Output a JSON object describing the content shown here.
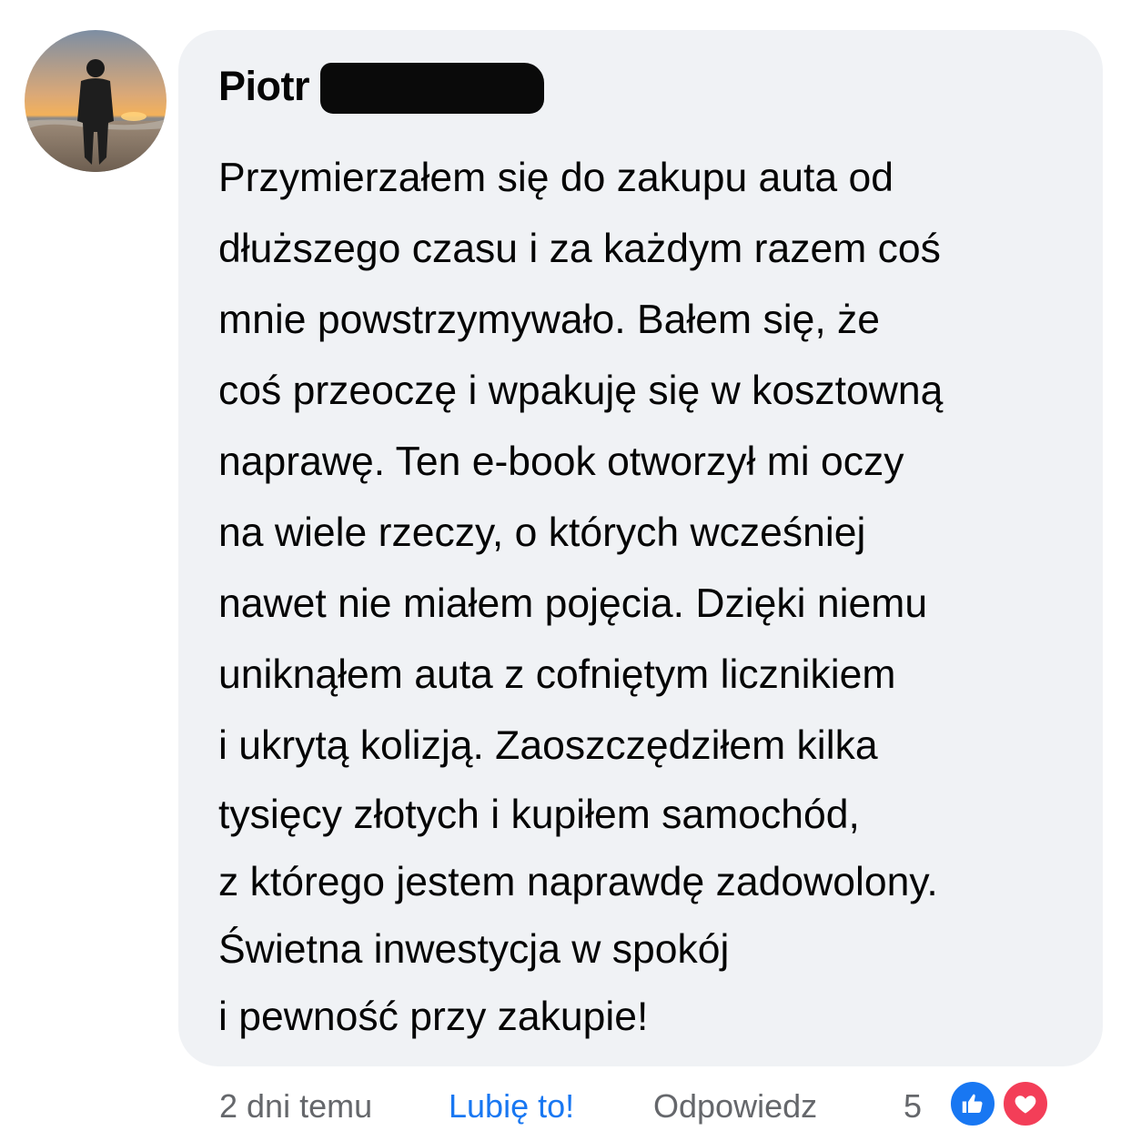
{
  "comment": {
    "author": "Piotr",
    "lines": [
      "Przymierzałem się do zakupu auta od",
      "dłuższego czasu i za każdym razem coś",
      "mnie powstrzymywało. Bałem się, że",
      "coś przeoczę i wpakuję się w kosztowną",
      "naprawę. Ten e-book otworzył mi oczy",
      "na wiele rzeczy, o których wcześniej",
      "nawet nie miałem pojęcia. Dzięki niemu",
      "uniknąłem auta z cofniętym licznikiem",
      "i ukrytą kolizją. Zaoszczędziłem kilka",
      "tysięcy złotych i kupiłem samochód,",
      "z którego jestem naprawdę zadowolony.",
      "Świetna inwestycja w spokój",
      "i pewność przy zakupie!"
    ]
  },
  "actions": {
    "time": "2 dni temu",
    "like_label": "Lubię to!",
    "reply_label": "Odpowiedz",
    "reaction_count": "5"
  },
  "reactions": [
    {
      "icon": "thumbs-up-icon",
      "color": "#1877f2"
    },
    {
      "icon": "heart-icon",
      "color": "#f33e58"
    }
  ],
  "colors": {
    "bubble": "#f0f2f5",
    "text": "#050505",
    "secondary": "#65676b",
    "link": "#1877f2"
  }
}
